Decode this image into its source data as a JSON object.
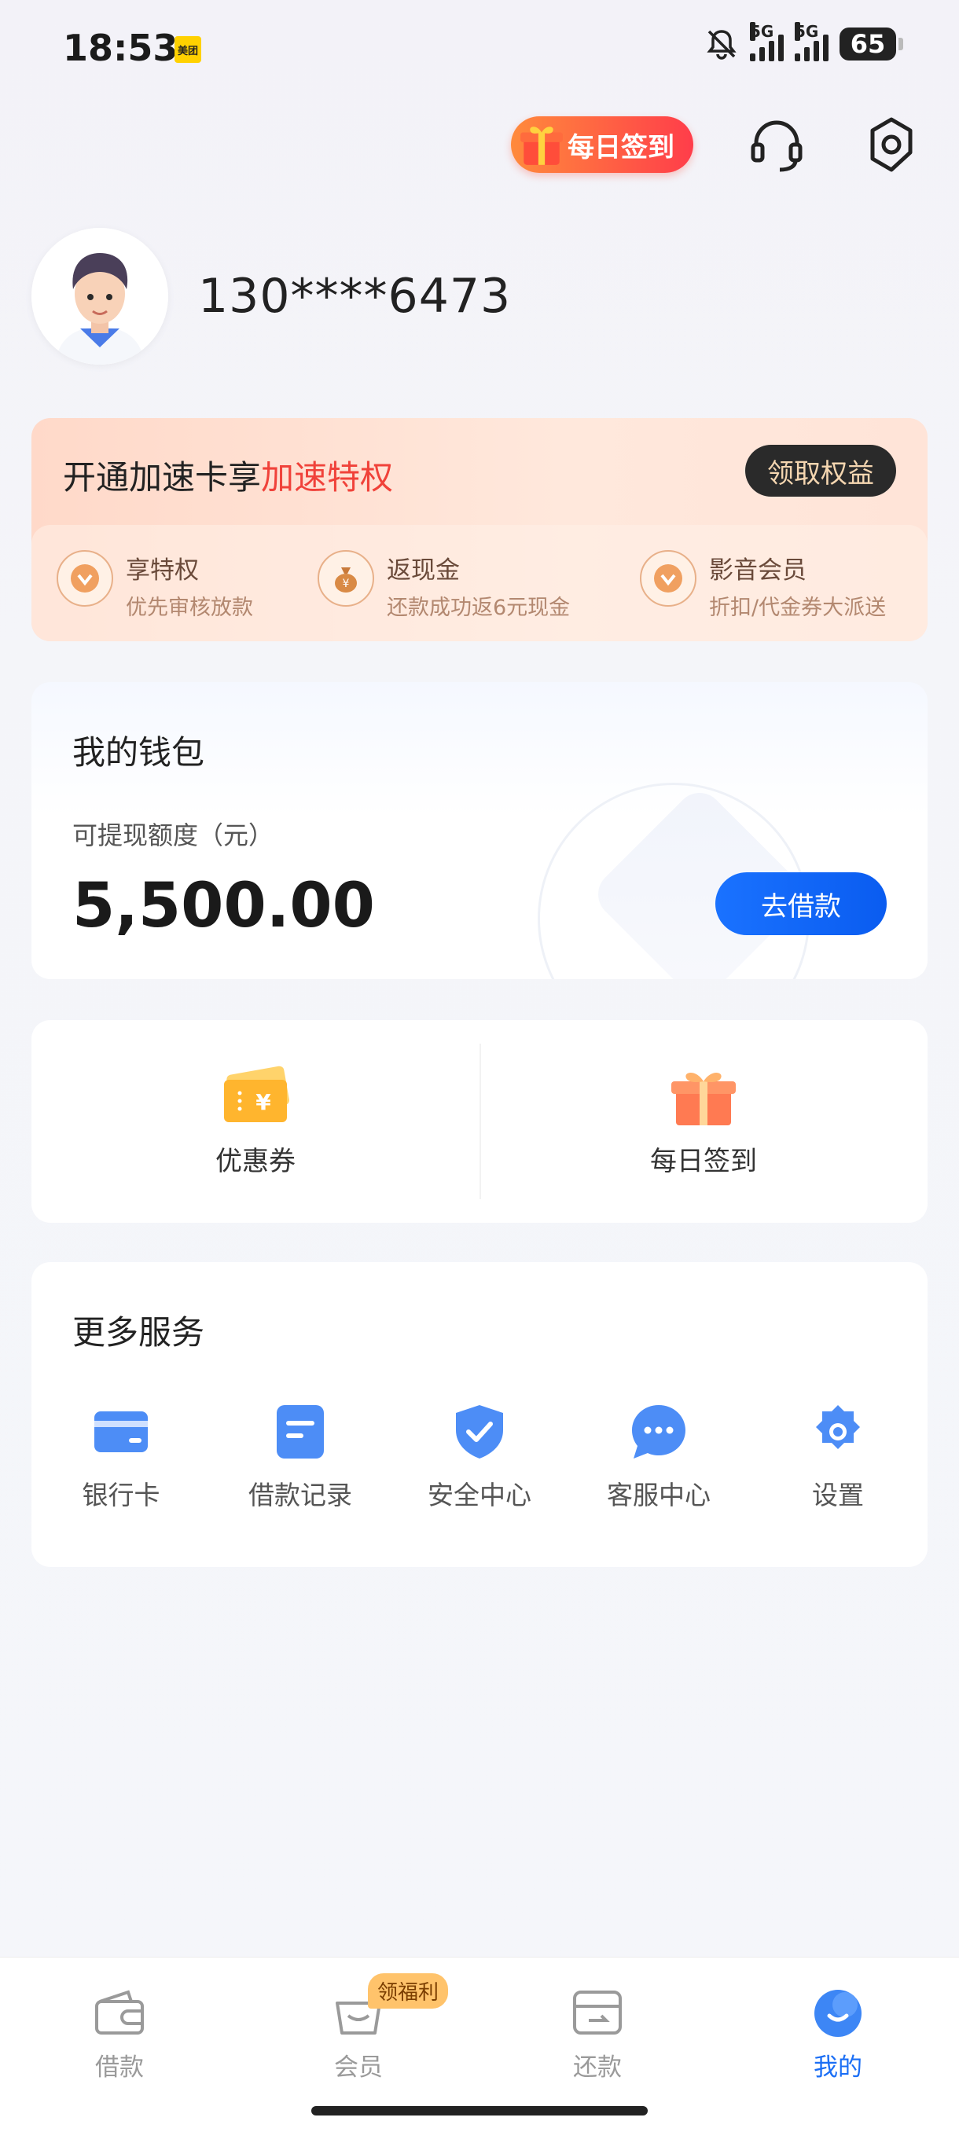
{
  "status_bar": {
    "time": "18:53",
    "app_badge": "美团",
    "signal1_label": "5G",
    "signal2_label": "5G",
    "battery": "65"
  },
  "header": {
    "checkin_label": "每日签到"
  },
  "profile": {
    "phone": "130****6473"
  },
  "accel_card": {
    "title_prefix": "开通加速卡享",
    "title_highlight": "加速特权",
    "claim_label": "领取权益",
    "perks": [
      {
        "title": "享特权",
        "sub": "优先审核放款",
        "icon": "heart-badge-icon"
      },
      {
        "title": "返现金",
        "sub": "还款成功返6元现金",
        "icon": "money-bag-icon"
      },
      {
        "title": "影音会员",
        "sub": "折扣/代金券大派送",
        "icon": "heart-badge-icon"
      }
    ]
  },
  "wallet": {
    "title": "我的钱包",
    "label": "可提现额度（元）",
    "amount": "5,500.00",
    "borrow_label": "去借款"
  },
  "quick": [
    {
      "label": "优惠券",
      "icon": "coupon-icon"
    },
    {
      "label": "每日签到",
      "icon": "gift-icon"
    }
  ],
  "services": {
    "title": "更多服务",
    "items": [
      {
        "label": "银行卡",
        "icon": "bank-card-icon"
      },
      {
        "label": "借款记录",
        "icon": "record-icon"
      },
      {
        "label": "安全中心",
        "icon": "shield-icon"
      },
      {
        "label": "客服中心",
        "icon": "chat-icon"
      },
      {
        "label": "设置",
        "icon": "gear-icon"
      }
    ]
  },
  "nav": {
    "items": [
      {
        "label": "借款",
        "icon": "wallet-icon"
      },
      {
        "label": "会员",
        "icon": "basket-icon",
        "badge": "领福利"
      },
      {
        "label": "还款",
        "icon": "repay-icon"
      },
      {
        "label": "我的",
        "icon": "profile-icon",
        "active": true
      }
    ]
  },
  "colors": {
    "accent": "#1a6ef5",
    "highlight": "#f0423a",
    "claim_text": "#f5d6b0"
  }
}
